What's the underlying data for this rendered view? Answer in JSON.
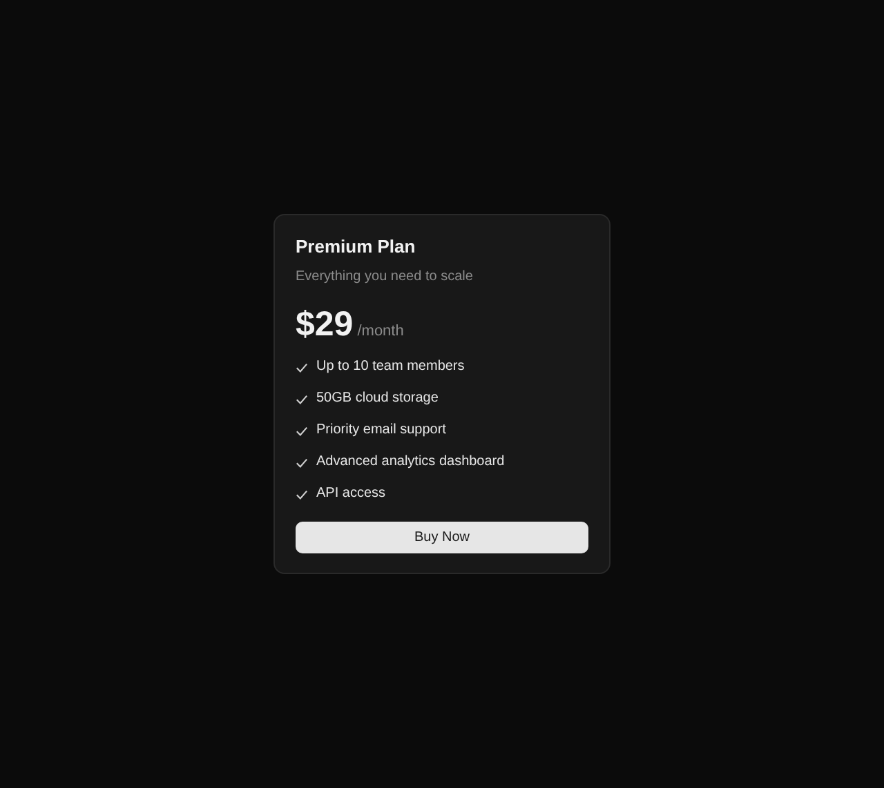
{
  "card": {
    "title": "Premium Plan",
    "subtitle": "Everything you need to scale",
    "price": "$29",
    "period": "/month",
    "features": [
      "Up to 10 team members",
      "50GB cloud storage",
      "Priority email support",
      "Advanced analytics dashboard",
      "API access"
    ],
    "button": "Buy Now"
  }
}
